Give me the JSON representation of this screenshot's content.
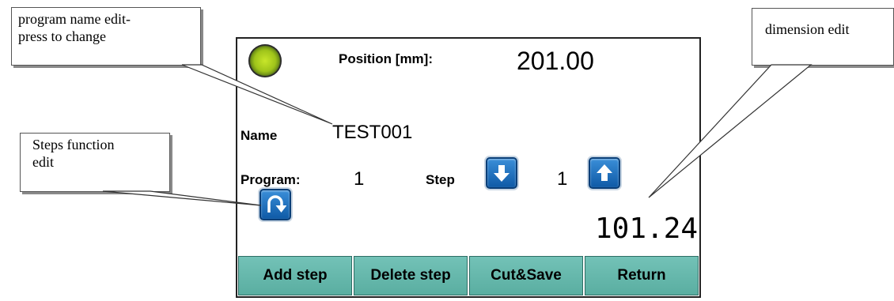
{
  "screen": {
    "position_label": "Position [mm]:",
    "position_value": "201.00",
    "name_label": "Name",
    "name_value": "TEST001",
    "program_label": "Program:",
    "program_value": "1",
    "step_label": "Step",
    "step_value": "1",
    "dimension_value": "101.24",
    "status_led_color": "#9fc41a"
  },
  "buttons": {
    "step_down_icon": "arrow-down-icon",
    "step_up_icon": "arrow-up-icon",
    "steps_function_icon": "loop-arrow-icon"
  },
  "function_keys": {
    "add_step": "Add step",
    "delete_step": "Delete step",
    "cut_save": "Cut&Save",
    "return": "Return"
  },
  "callouts": {
    "program_name_line1": "program name edit-",
    "program_name_line2": "press to change",
    "dimension": "dimension edit",
    "steps_line1": "Steps function",
    "steps_line2": "edit"
  },
  "colors": {
    "accent_blue": "#1a6dc0",
    "function_key_teal": "#66b8ac"
  }
}
